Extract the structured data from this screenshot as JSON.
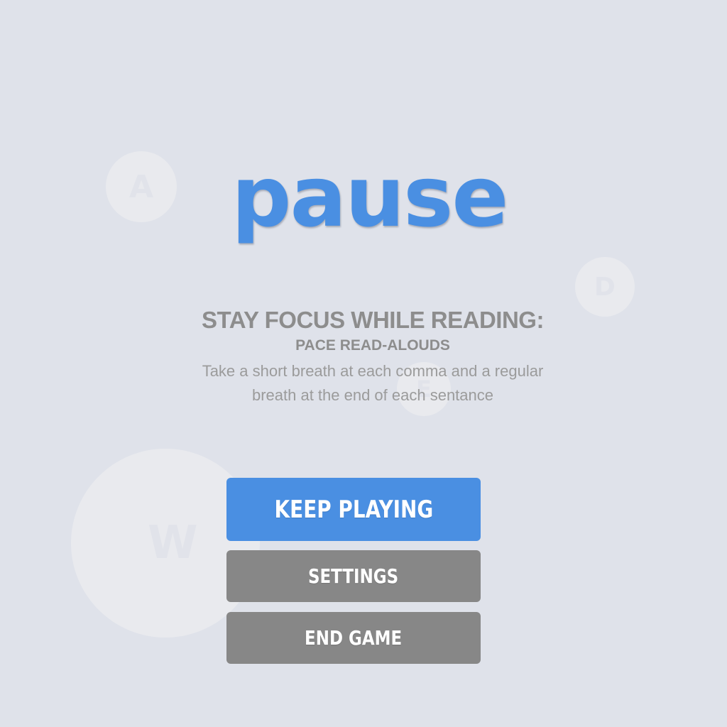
{
  "background_letters": {
    "a": "A",
    "d": "D",
    "e": "E",
    "w": "W"
  },
  "title": "pause",
  "tip": {
    "heading": "STAY FOCUS WHILE READING:",
    "subheading": "PACE READ-ALOUDS",
    "body": "Take a short breath at each comma and a regular breath at the end of each sentance"
  },
  "buttons": {
    "keep_playing": "KEEP PLAYING",
    "settings": "SETTINGS",
    "end_game": "END GAME"
  },
  "colors": {
    "background": "#dfe2ea",
    "accent": "#4a8fe2",
    "secondary_button": "#878787",
    "text_gray": "#8d8d8d"
  }
}
